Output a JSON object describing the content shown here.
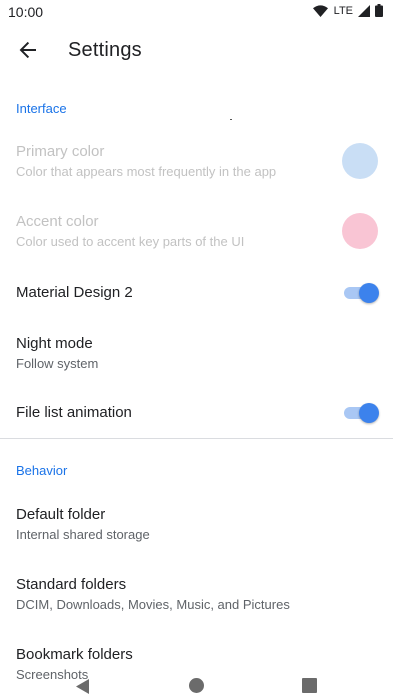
{
  "status_bar": {
    "time": "10:00",
    "network": "LTE",
    "icons": [
      "wifi-icon",
      "cellular-signal-icon",
      "battery-icon"
    ]
  },
  "app_bar": {
    "title": "Settings",
    "back_icon": "arrow-back-icon"
  },
  "sections": {
    "interface": {
      "header": "Interface",
      "primary_color": {
        "title": "Primary color",
        "subtitle": "Color that appears most frequently in the app",
        "swatch": "#c9def5",
        "enabled": false
      },
      "accent_color": {
        "title": "Accent color",
        "subtitle": "Color used to accent key parts of the UI",
        "swatch": "#f9c5d4",
        "enabled": false
      },
      "material_design_2": {
        "title": "Material Design 2",
        "checked": true
      },
      "night_mode": {
        "title": "Night mode",
        "subtitle": "Follow system"
      },
      "file_list_animation": {
        "title": "File list animation",
        "checked": true
      }
    },
    "behavior": {
      "header": "Behavior",
      "default_folder": {
        "title": "Default folder",
        "subtitle": "Internal shared storage"
      },
      "standard_folders": {
        "title": "Standard folders",
        "subtitle": "DCIM, Downloads, Movies, Music, and Pictures"
      },
      "bookmark_folders": {
        "title": "Bookmark folders",
        "subtitle": "Screenshots"
      }
    }
  },
  "colors": {
    "accent": "#1a73e8",
    "switch_thumb": "#3c82ec",
    "switch_track": "#a9c7f4",
    "disabled_text": "#c2c2c2"
  },
  "nav_bar": {
    "icons": [
      "nav-back-icon",
      "nav-home-icon",
      "nav-recents-icon"
    ]
  }
}
